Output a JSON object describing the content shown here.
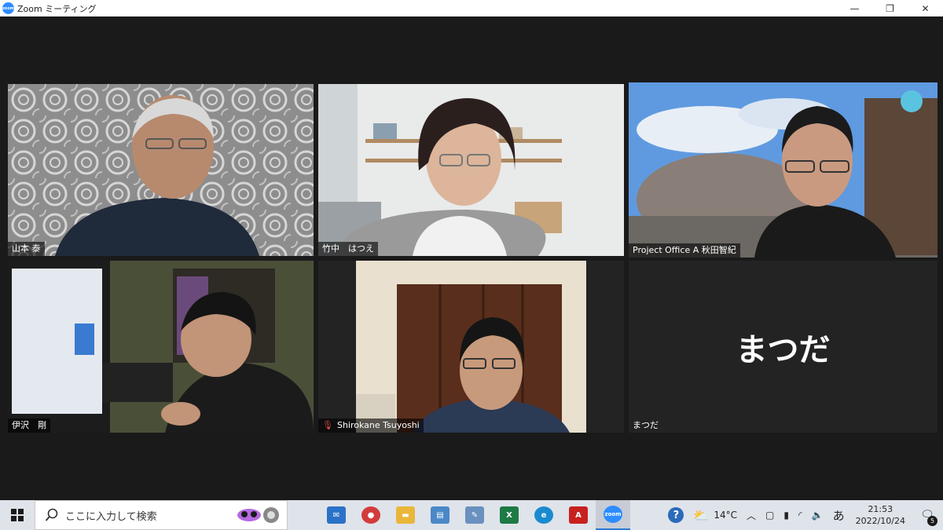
{
  "window": {
    "title": "Zoom ミーティング",
    "logo_text": "zoom",
    "minimize": "—",
    "restore": "❐",
    "close": "✕"
  },
  "participants": [
    {
      "name": "山本 泰"
    },
    {
      "name": "竹中　はつえ"
    },
    {
      "name": "Project Office A 秋田智紀"
    },
    {
      "name": "伊沢　剛"
    },
    {
      "name": "Shirokane Tsuyoshi",
      "muted": true
    },
    {
      "name": "まつだ",
      "display_name": "まつだ"
    }
  ],
  "taskbar": {
    "search_placeholder": "ここに入力して検索",
    "apps": [
      {
        "id": "mail",
        "label": "✉",
        "color": "#2a72c8"
      },
      {
        "id": "photos",
        "label": "●",
        "color": "#d33b3b"
      },
      {
        "id": "explorer",
        "label": "▬",
        "color": "#e8b73a"
      },
      {
        "id": "notes",
        "label": "▤",
        "color": "#4a88c8"
      },
      {
        "id": "paint",
        "label": "✎",
        "color": "#6a90c0"
      },
      {
        "id": "excel",
        "label": "X",
        "color": "#1d7a45"
      },
      {
        "id": "edge",
        "label": "e",
        "color": "#1a8ad0"
      },
      {
        "id": "acrobat",
        "label": "A",
        "color": "#c8201e"
      },
      {
        "id": "zoom",
        "label": "zoom",
        "color": "#2d8cff",
        "active": true
      }
    ],
    "weather": "14°C",
    "ime": "あ",
    "time": "21:53",
    "date": "2022/10/24",
    "notification_count": "5"
  }
}
